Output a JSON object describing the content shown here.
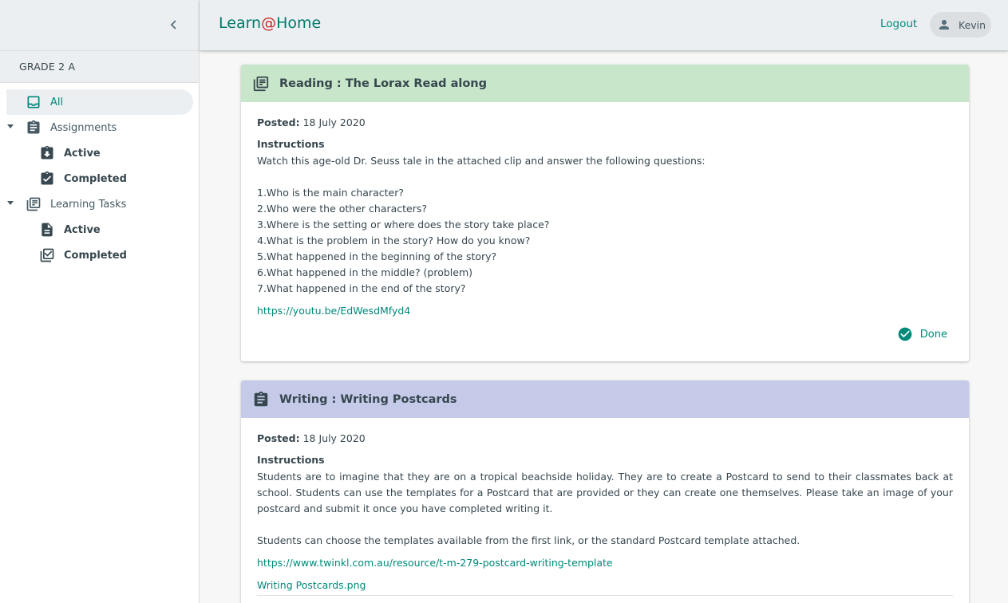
{
  "app": {
    "brand_prefix": "Learn",
    "brand_at": "@",
    "brand_suffix": "Home",
    "logout_label": "Logout",
    "user_name": "Kevin"
  },
  "sidebar": {
    "class_name": "GRADE 2 A",
    "items": [
      {
        "label": "All",
        "icon": "inbox-icon"
      },
      {
        "label": "Assignments",
        "icon": "clipboard-icon"
      },
      {
        "label": "Active",
        "icon": "clipboard-download-icon"
      },
      {
        "label": "Completed",
        "icon": "clipboard-check-icon"
      },
      {
        "label": "Learning Tasks",
        "icon": "library-books-icon"
      },
      {
        "label": "Active",
        "icon": "document-icon"
      },
      {
        "label": "Completed",
        "icon": "library-check-icon"
      }
    ]
  },
  "colors": {
    "accent": "#00897b",
    "brand_at": "#c62828",
    "reading_header": "#c8e6c9",
    "writing_header": "#c5cae9"
  },
  "cards": [
    {
      "title": "Reading : The Lorax Read along",
      "icon": "library-books-icon",
      "posted_label": "Posted:",
      "posted_date": "18 July 2020",
      "instructions_label": "Instructions",
      "instructions": "Watch this age-old Dr. Seuss tale in the attached clip and answer the following questions:\n\n1.Who is the main character?\n2.Who were the other characters?\n3.Where is the setting or where does the story take place?\n4.What is the problem in the story? How do you know?\n5.What happened in the beginning of the story?\n6.What happened in the middle? (problem)\n7.What happened in the end of the story?",
      "link": "https://youtu.be/EdWesdMfyd4",
      "status": "Done"
    },
    {
      "title": "Writing : Writing Postcards",
      "icon": "clipboard-icon",
      "posted_label": "Posted:",
      "posted_date": "18 July 2020",
      "instructions_label": "Instructions",
      "instructions": "Students are to imagine that they are on a tropical beachside holiday. They are to create a Postcard to send to their classmates back at school. Students can use the templates for a Postcard that are provided or they can create one themselves. Please take an image of your postcard and submit it once you have completed writing it.\n\nStudents can choose the templates available from the first link, or the standard Postcard template attached.",
      "link": "https://www.twinkl.com.au/resource/t-m-279-postcard-writing-template",
      "attachment": "Writing Postcards.png"
    }
  ]
}
